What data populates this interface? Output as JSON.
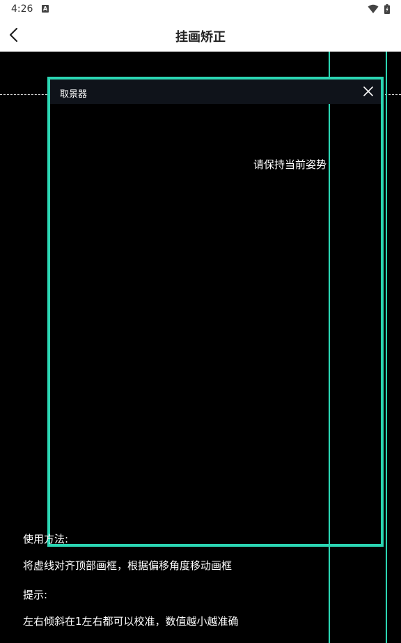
{
  "status_bar": {
    "time": "4:26",
    "notification_icon": "a-badge-icon",
    "wifi_icon": "wifi-icon",
    "battery_icon": "battery-icon"
  },
  "app_bar": {
    "title": "挂画矫正",
    "back_icon": "chevron-left-icon"
  },
  "viewfinder": {
    "title": "取景器",
    "close_icon": "close-icon",
    "hint": "请保持当前姿势",
    "accent_color": "#2bd6b3"
  },
  "instructions": {
    "usage_title": "使用方法:",
    "usage_text": "将虚线对齐顶部画框，根据偏移角度移动画框",
    "tip_title": "提示:",
    "tip_text": "左右倾斜在1左右都可以校准，数值越小越准确"
  }
}
